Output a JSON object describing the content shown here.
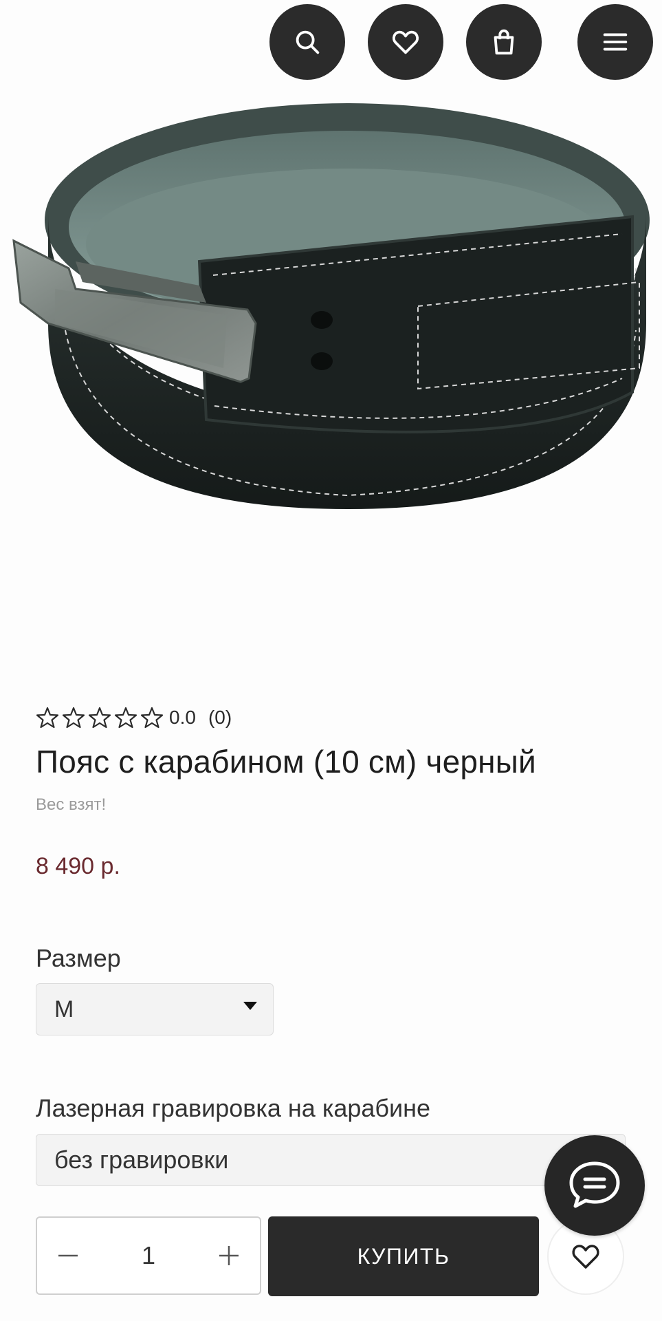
{
  "header": {
    "icons": [
      "search-icon",
      "heart-icon",
      "shopping-bag-icon",
      "menu-icon"
    ]
  },
  "product": {
    "image_alt": "Пояс с карабином (10 см) черный",
    "rating_value": "0.0",
    "rating_count": "(0)",
    "stars_filled": 0,
    "stars_total": 5,
    "title": "Пояс с карабином (10 см) черный",
    "brand_tag": "Вес взят!",
    "price": "8 490 р."
  },
  "options": {
    "size_label": "Размер",
    "size_value": "M",
    "engraving_label": "Лазерная гравировка на карабине",
    "engraving_value": "без гравировки"
  },
  "purchase": {
    "quantity": "1",
    "buy_label": "КУПИТЬ"
  },
  "colors": {
    "dark": "#2b2b2b",
    "price": "#6a2a2f"
  }
}
